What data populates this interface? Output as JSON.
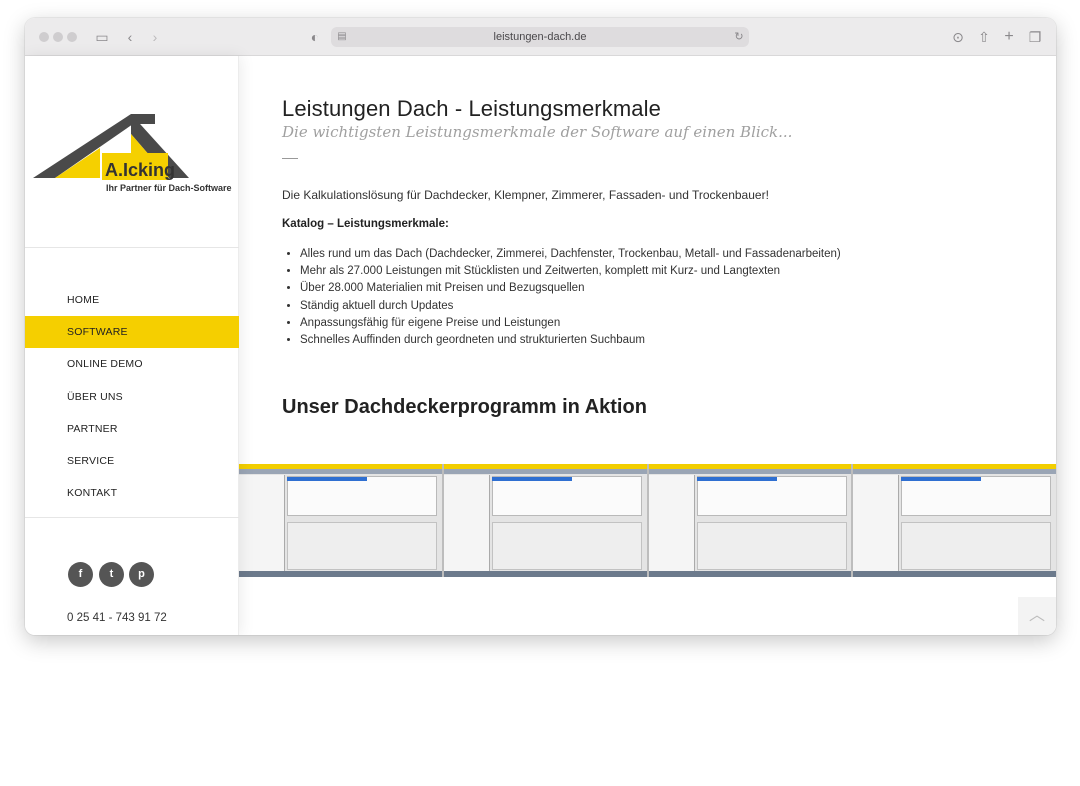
{
  "browser": {
    "url": "leistungen-dach.de"
  },
  "logo": {
    "brand": "A.Icking",
    "tagline": "Ihr Partner für Dach-Software"
  },
  "nav": {
    "items": [
      {
        "label": "HOME"
      },
      {
        "label": "SOFTWARE"
      },
      {
        "label": "ONLINE DEMO"
      },
      {
        "label": "ÜBER UNS"
      },
      {
        "label": "PARTNER"
      },
      {
        "label": "SERVICE"
      },
      {
        "label": "KONTAKT"
      }
    ],
    "active": "SOFTWARE"
  },
  "social": {
    "icons": [
      "facebook-icon",
      "twitter-icon",
      "pinterest-icon"
    ]
  },
  "contact": {
    "phone": "0 25 41 - 743 91 72"
  },
  "main": {
    "title": "Leistungen Dach - Leistungsmerkmale",
    "subtitle": "Die wichtigsten Leistungsmerkmale der Software auf einen Blick...",
    "intro": "Die Kalkulationslösung für Dachdecker, Klempner, Zimmerer, Fassaden- und Trockenbauer!",
    "katalog_heading": "Katalog – Leistungsmerkmale:",
    "features": [
      "Alles rund um das Dach (Dachdecker, Zimmerei, Dachfenster, Trockenbau, Metall- und Fassadenarbeiten)",
      "Mehr als 27.000 Leistungen mit Stücklisten und Zeitwerten, komplett mit Kurz- und Langtexten",
      "Über 28.000 Materialien mit Preisen und Bezugsquellen",
      "Ständig aktuell durch Updates",
      "Anpassungsfähig für eigene Preise und Leistungen",
      "Schnelles Auffinden durch geordneten und strukturierten Suchbaum"
    ],
    "section_title": "Unser Dachdeckerprogramm in Aktion"
  },
  "colors": {
    "accent": "#f5cf00",
    "logo_dark": "#4a4a4a",
    "logo_yellow": "#f5d000"
  }
}
